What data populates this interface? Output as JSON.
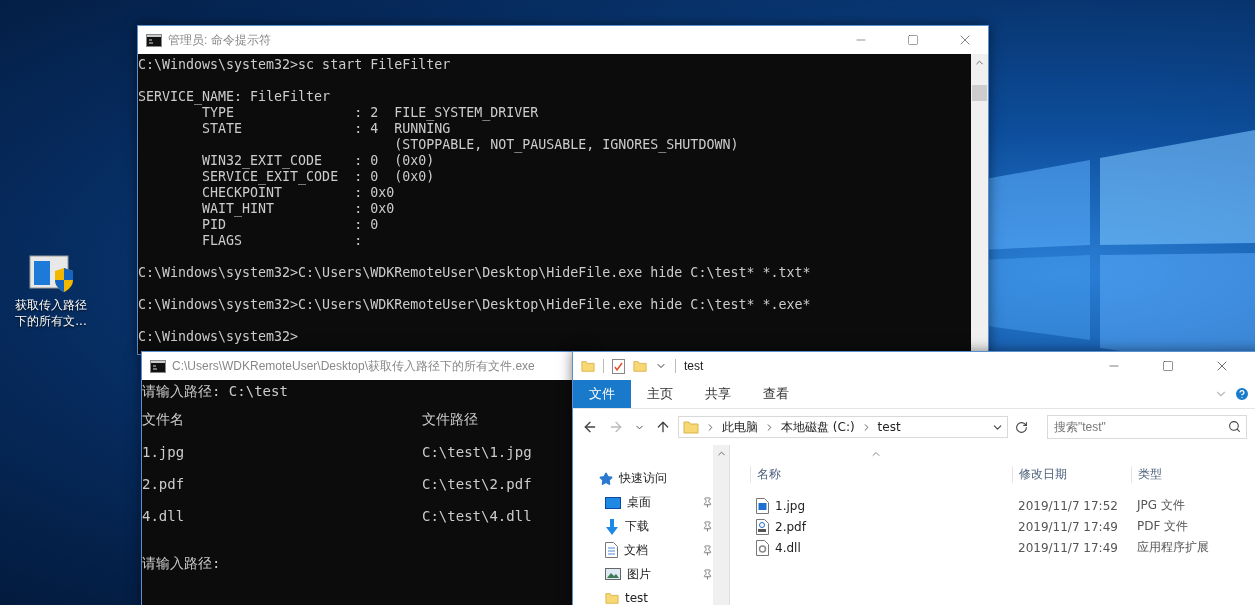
{
  "desktop_icon": {
    "label": "获取传入路径下的所有文..."
  },
  "cmd_window": {
    "title": "管理员: 命令提示符",
    "blocks": [
      [
        "C:\\Windows\\system32>sc start FileFilter"
      ],
      [
        "SERVICE_NAME: FileFilter",
        "        TYPE               : 2  FILE_SYSTEM_DRIVER",
        "        STATE              : 4  RUNNING",
        "                                (STOPPABLE, NOT_PAUSABLE, IGNORES_SHUTDOWN)",
        "        WIN32_EXIT_CODE    : 0  (0x0)",
        "        SERVICE_EXIT_CODE  : 0  (0x0)",
        "        CHECKPOINT         : 0x0",
        "        WAIT_HINT          : 0x0",
        "        PID                : 0",
        "        FLAGS              :"
      ],
      [
        "C:\\Windows\\system32>C:\\Users\\WDKRemoteUser\\Desktop\\HideFile.exe hide C:\\test* *.txt*"
      ],
      [
        "C:\\Windows\\system32>C:\\Users\\WDKRemoteUser\\Desktop\\HideFile.exe hide C:\\test* *.exe*"
      ],
      [
        "C:\\Windows\\system32>"
      ]
    ]
  },
  "console_window": {
    "title": "C:\\Users\\WDKRemoteUser\\Desktop\\获取传入路径下的所有文件.exe",
    "lines": [
      {
        "kind": "text",
        "text": "请输入路径: C:\\test"
      },
      {
        "kind": "columns",
        "cells": [
          "文件名",
          "文件路径"
        ]
      },
      {
        "kind": "columns",
        "cells": [
          "1.jpg",
          "C:\\test\\1.jpg"
        ]
      },
      {
        "kind": "columns",
        "cells": [
          "2.pdf",
          "C:\\test\\2.pdf"
        ]
      },
      {
        "kind": "columns",
        "cells": [
          "4.dll",
          "C:\\test\\4.dll"
        ]
      },
      {
        "kind": "blank"
      },
      {
        "kind": "text",
        "text": "请输入路径:"
      }
    ]
  },
  "explorer": {
    "title": "test",
    "ribbon_tabs": [
      {
        "label": "文件",
        "selected": true
      },
      {
        "label": "主页",
        "selected": false
      },
      {
        "label": "共享",
        "selected": false
      },
      {
        "label": "查看",
        "selected": false
      }
    ],
    "breadcrumb": [
      "此电脑",
      "本地磁盘 (C:)",
      "test"
    ],
    "search": {
      "placeholder": "搜索\"test\""
    },
    "nav_items": [
      {
        "kind": "quick-access",
        "label": "快速访问",
        "pinned": false
      },
      {
        "kind": "desktop",
        "label": "桌面",
        "pinned": true
      },
      {
        "kind": "downloads",
        "label": "下载",
        "pinned": true
      },
      {
        "kind": "documents",
        "label": "文档",
        "pinned": true
      },
      {
        "kind": "pictures",
        "label": "图片",
        "pinned": true
      },
      {
        "kind": "folder",
        "label": "test",
        "pinned": false
      }
    ],
    "columns": [
      "名称",
      "修改日期",
      "类型"
    ],
    "files": [
      {
        "kind": "image",
        "name": "1.jpg",
        "modified": "2019/11/7 17:52",
        "type": "JPG 文件"
      },
      {
        "kind": "pdf",
        "name": "2.pdf",
        "modified": "2019/11/7 17:49",
        "type": "PDF 文件"
      },
      {
        "kind": "dll",
        "name": "4.dll",
        "modified": "2019/11/7 17:49",
        "type": "应用程序扩展"
      }
    ]
  }
}
